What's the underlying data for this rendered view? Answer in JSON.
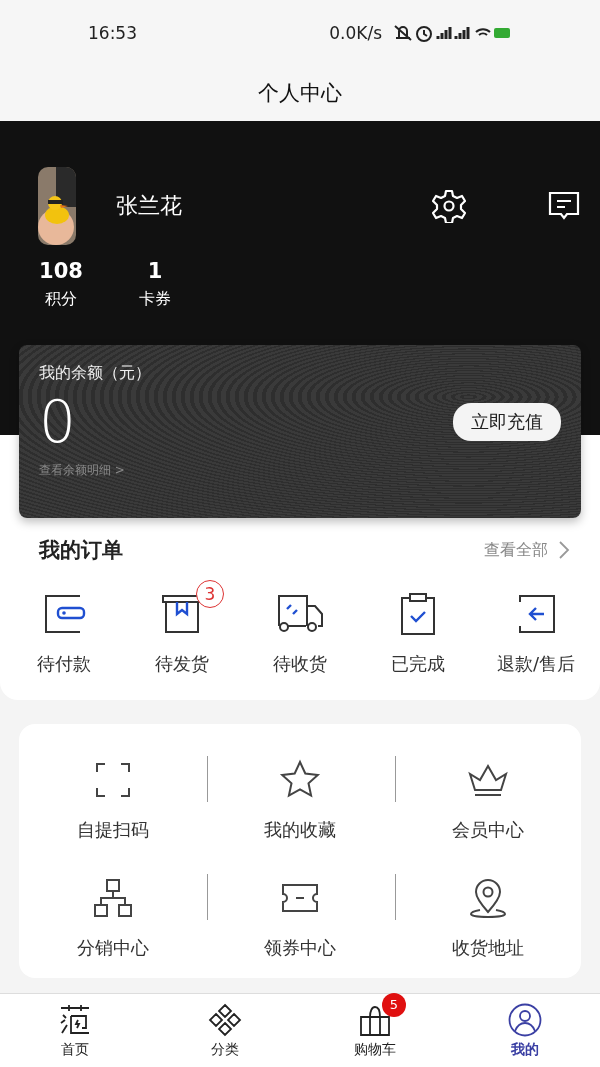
{
  "status_bar": {
    "time": "16:53",
    "net_speed": "0.0K/s"
  },
  "header": {
    "title": "个人中心"
  },
  "profile": {
    "name": "张兰花",
    "stats": [
      {
        "value": "108",
        "label": "积分"
      },
      {
        "value": "1",
        "label": "卡券"
      }
    ]
  },
  "balance": {
    "label": "我的余额（元）",
    "amount": "0",
    "detail_link": "查看余额明细 >",
    "button": "立即充值"
  },
  "orders": {
    "title": "我的订单",
    "view_all": "查看全部",
    "items": [
      {
        "kind": "wallet",
        "label": "待付款"
      },
      {
        "kind": "box",
        "label": "待发货",
        "badge": "3"
      },
      {
        "kind": "truck",
        "label": "待收货"
      },
      {
        "kind": "clipboard",
        "label": "已完成"
      },
      {
        "kind": "return",
        "label": "退款/售后"
      }
    ]
  },
  "services": [
    {
      "kind": "scan",
      "label": "自提扫码"
    },
    {
      "kind": "star",
      "label": "我的收藏"
    },
    {
      "kind": "crown",
      "label": "会员中心"
    },
    {
      "kind": "tree",
      "label": "分销中心"
    },
    {
      "kind": "ticket",
      "label": "领券中心"
    },
    {
      "kind": "pin",
      "label": "收货地址"
    }
  ],
  "tab_bar": [
    {
      "kind": "home",
      "label": "首页",
      "selected": false
    },
    {
      "kind": "category",
      "label": "分类",
      "selected": false
    },
    {
      "kind": "cart",
      "label": "购物车",
      "badge": "5",
      "selected": false
    },
    {
      "kind": "profile",
      "label": "我的",
      "selected": true
    }
  ]
}
